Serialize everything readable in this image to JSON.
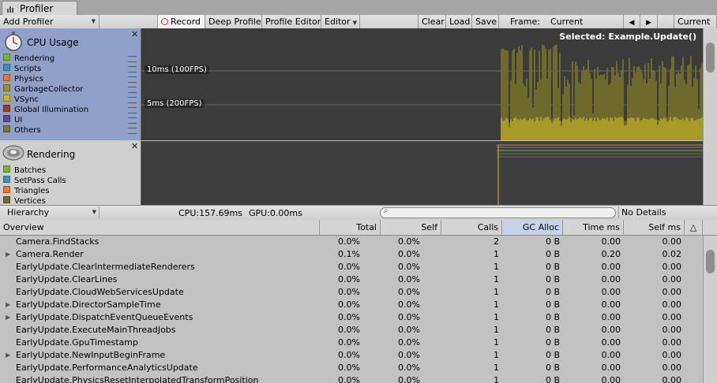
{
  "window": {
    "tab_title": "Profiler"
  },
  "toolbar": {
    "add_profiler": "Add Profiler",
    "record": "Record",
    "deep_profile": "Deep Profile",
    "profiler_editor": "Profile Editor",
    "editor": "Editor",
    "clear": "Clear",
    "load": "Load",
    "save": "Save",
    "frame_label": "Frame:",
    "frame_value": "Current",
    "current_button": "Current"
  },
  "cpu_panel": {
    "title": "CPU Usage",
    "items": [
      {
        "label": "Rendering",
        "color": "#7ab33a"
      },
      {
        "label": "Scripts",
        "color": "#3f8fc4"
      },
      {
        "label": "Physics",
        "color": "#e07a2c"
      },
      {
        "label": "GarbageCollector",
        "color": "#a38f1a"
      },
      {
        "label": "VSync",
        "color": "#c9b420"
      },
      {
        "label": "Global Illumination",
        "color": "#a33a2a"
      },
      {
        "label": "UI",
        "color": "#5a4d9c"
      },
      {
        "label": "Others",
        "color": "#7a7a2a"
      }
    ]
  },
  "render_panel": {
    "title": "Rendering",
    "items": [
      {
        "label": "Batches",
        "color": "#7ab33a"
      },
      {
        "label": "SetPass Calls",
        "color": "#3f8fc4"
      },
      {
        "label": "Triangles",
        "color": "#e07a2c"
      },
      {
        "label": "Vertices",
        "color": "#7a6a2a"
      }
    ]
  },
  "graph": {
    "selected": "Selected: Example.Update()",
    "line_10ms": "10ms (100FPS)",
    "line_5ms": "5ms (200FPS)"
  },
  "hierarchy_bar": {
    "view": "Hierarchy",
    "cpu": "CPU:157.69ms",
    "gpu": "GPU:0.00ms",
    "search_placeholder": "",
    "details": "No Details"
  },
  "table": {
    "headers": [
      "Overview",
      "Total",
      "Self",
      "Calls",
      "GC Alloc",
      "Time ms",
      "Self ms"
    ],
    "rows": [
      {
        "name": "Camera.FindStacks",
        "expandable": false,
        "total": "0.0%",
        "self": "0.0%",
        "calls": "2",
        "gc": "0 B",
        "time": "0.00",
        "selfms": "0.00"
      },
      {
        "name": "Camera.Render",
        "expandable": true,
        "total": "0.1%",
        "self": "0.0%",
        "calls": "1",
        "gc": "0 B",
        "time": "0.20",
        "selfms": "0.02"
      },
      {
        "name": "EarlyUpdate.ClearIntermediateRenderers",
        "expandable": false,
        "total": "0.0%",
        "self": "0.0%",
        "calls": "1",
        "gc": "0 B",
        "time": "0.00",
        "selfms": "0.00"
      },
      {
        "name": "EarlyUpdate.ClearLines",
        "expandable": false,
        "total": "0.0%",
        "self": "0.0%",
        "calls": "1",
        "gc": "0 B",
        "time": "0.00",
        "selfms": "0.00"
      },
      {
        "name": "EarlyUpdate.CloudWebServicesUpdate",
        "expandable": false,
        "total": "0.0%",
        "self": "0.0%",
        "calls": "1",
        "gc": "0 B",
        "time": "0.00",
        "selfms": "0.00"
      },
      {
        "name": "EarlyUpdate.DirectorSampleTime",
        "expandable": true,
        "total": "0.0%",
        "self": "0.0%",
        "calls": "1",
        "gc": "0 B",
        "time": "0.00",
        "selfms": "0.00"
      },
      {
        "name": "EarlyUpdate.DispatchEventQueueEvents",
        "expandable": true,
        "total": "0.0%",
        "self": "0.0%",
        "calls": "1",
        "gc": "0 B",
        "time": "0.00",
        "selfms": "0.00"
      },
      {
        "name": "EarlyUpdate.ExecuteMainThreadJobs",
        "expandable": false,
        "total": "0.0%",
        "self": "0.0%",
        "calls": "1",
        "gc": "0 B",
        "time": "0.00",
        "selfms": "0.00"
      },
      {
        "name": "EarlyUpdate.GpuTimestamp",
        "expandable": false,
        "total": "0.0%",
        "self": "0.0%",
        "calls": "1",
        "gc": "0 B",
        "time": "0.00",
        "selfms": "0.00"
      },
      {
        "name": "EarlyUpdate.NewInputBeginFrame",
        "expandable": true,
        "total": "0.0%",
        "self": "0.0%",
        "calls": "1",
        "gc": "0 B",
        "time": "0.00",
        "selfms": "0.00"
      },
      {
        "name": "EarlyUpdate.PerformanceAnalyticsUpdate",
        "expandable": false,
        "total": "0.0%",
        "self": "0.0%",
        "calls": "1",
        "gc": "0 B",
        "time": "0.00",
        "selfms": "0.00"
      },
      {
        "name": "EarlyUpdate.PhysicsResetInterpolatedTransformPosition",
        "expandable": false,
        "total": "0.0%",
        "self": "0.0%",
        "calls": "1",
        "gc": "0 B",
        "time": "0.00",
        "selfms": "0.00"
      }
    ]
  }
}
